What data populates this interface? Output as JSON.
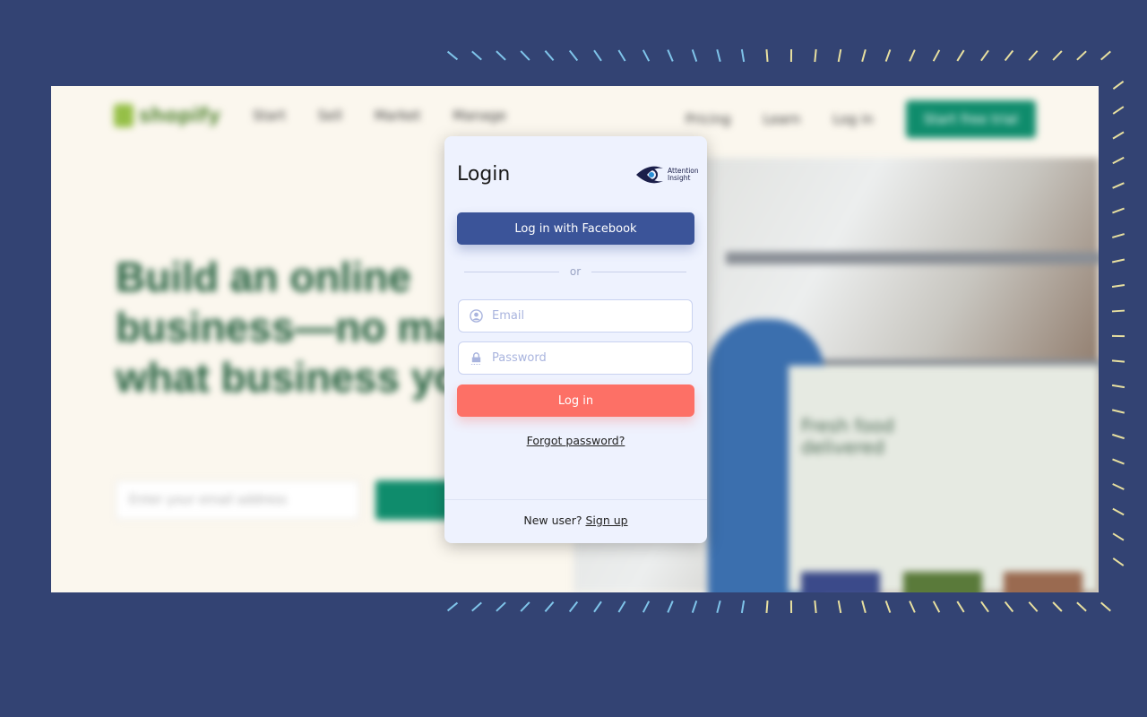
{
  "background_site": {
    "logo": "shopify",
    "nav": [
      "Start",
      "Sell",
      "Market",
      "Manage"
    ],
    "nav_right": [
      "Pricing",
      "Learn",
      "Log in"
    ],
    "cta": "Start free trial",
    "headline": "Build an online business—no matter what business you're in",
    "email_placeholder": "Enter your email address",
    "card_title": "Fresh food delivered"
  },
  "modal": {
    "title": "Login",
    "brand": "Attention Insight",
    "facebook_button": "Log in with Facebook",
    "divider": "or",
    "email_placeholder": "Email",
    "password_placeholder": "Password",
    "login_button": "Log in",
    "forgot_link": "Forgot password?",
    "new_user_text": "New user?",
    "signup_link": "Sign up"
  },
  "colors": {
    "background": "#334373",
    "facebook": "#3b5499",
    "login": "#fd7066",
    "modal": "#eef2fe"
  }
}
